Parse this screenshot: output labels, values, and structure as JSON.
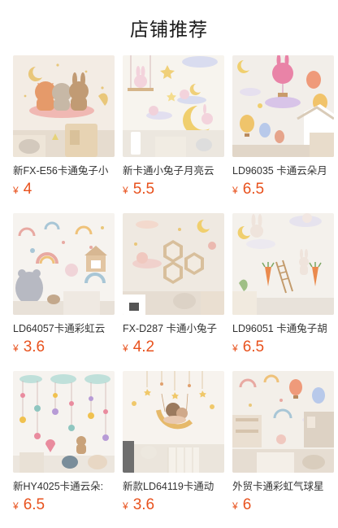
{
  "header": {
    "title": "店铺推荐"
  },
  "products": [
    {
      "title": "新FX-E56卡通兔子小",
      "currency": "¥",
      "price": "4"
    },
    {
      "title": "新卡通小兔子月亮云",
      "currency": "¥",
      "price": "5.5"
    },
    {
      "title": "LD96035 卡通云朵月",
      "currency": "¥",
      "price": "6.5"
    },
    {
      "title": "LD64057卡通彩虹云",
      "currency": "¥",
      "price": "3.6"
    },
    {
      "title": "FX-D287 卡通小兔子",
      "currency": "¥",
      "price": "4.2"
    },
    {
      "title": "LD96051 卡通兔子胡",
      "currency": "¥",
      "price": "6.5"
    },
    {
      "title": "新HY4025卡通云朵:",
      "currency": "¥",
      "price": "6.5"
    },
    {
      "title": "新款LD64119卡通动",
      "currency": "¥",
      "price": "3.6"
    },
    {
      "title": "外贸卡通彩虹气球星",
      "currency": "¥",
      "price": "6"
    }
  ],
  "colors": {
    "price": "#e8521e"
  }
}
